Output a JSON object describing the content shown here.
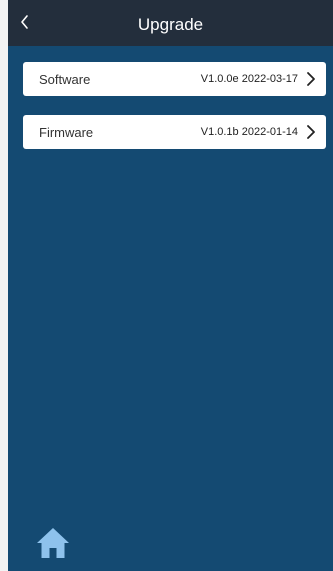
{
  "header": {
    "title": "Upgrade",
    "back_icon": "chevron-left-icon"
  },
  "items": [
    {
      "label": "Software",
      "value": "V1.0.0e 2022-03-17",
      "icon": "chevron-right-icon"
    },
    {
      "label": "Firmware",
      "value": "V1.0.1b 2022-01-14",
      "icon": "chevron-right-icon"
    }
  ],
  "footer": {
    "home_icon": "home-icon"
  },
  "colors": {
    "header_bg": "#232e3c",
    "page_bg": "#144a72",
    "card_bg": "#ffffff",
    "home_icon": "#8ec2ec"
  }
}
